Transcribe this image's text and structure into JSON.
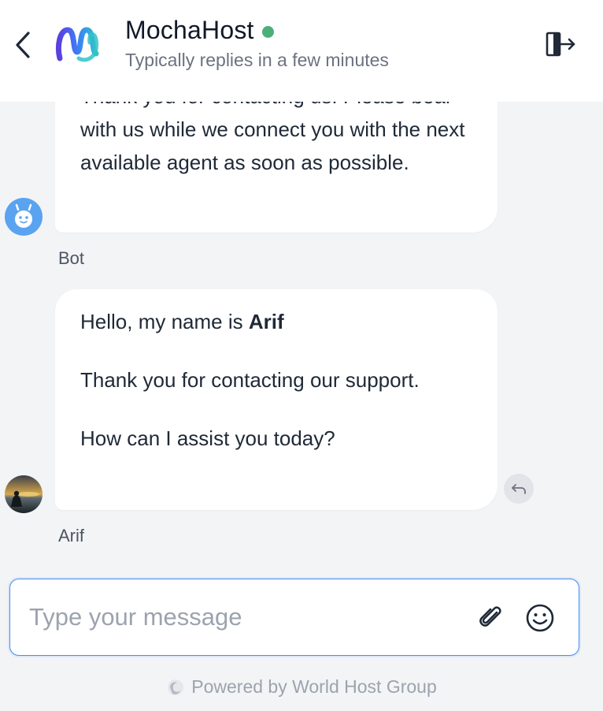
{
  "header": {
    "title": "MochaHost",
    "status_color": "#4caf7a",
    "subtitle": "Typically replies in a few minutes",
    "back_icon": "chevron-left-icon",
    "exit_icon": "exit-door-icon"
  },
  "messages": [
    {
      "sender": "Bot",
      "avatar": "bot-face-icon",
      "text": "Thank you for contacting us. Please bear with us while we connect you with the next available agent as soon as possible."
    },
    {
      "sender": "Arif",
      "avatar": "agent-photo",
      "greeting_prefix": "Hello, my name is ",
      "greeting_name": "Arif",
      "line2": "Thank you for contacting our support.",
      "line3": "How can I assist you today?",
      "reply_icon": "reply-arrow-icon"
    }
  ],
  "composer": {
    "placeholder": "Type your message",
    "attach_icon": "paperclip-icon",
    "emoji_icon": "smiley-icon",
    "border_color": "#4a8ef0"
  },
  "footer": {
    "text": "Powered by World Host Group",
    "logo_icon": "world-host-group-icon"
  }
}
